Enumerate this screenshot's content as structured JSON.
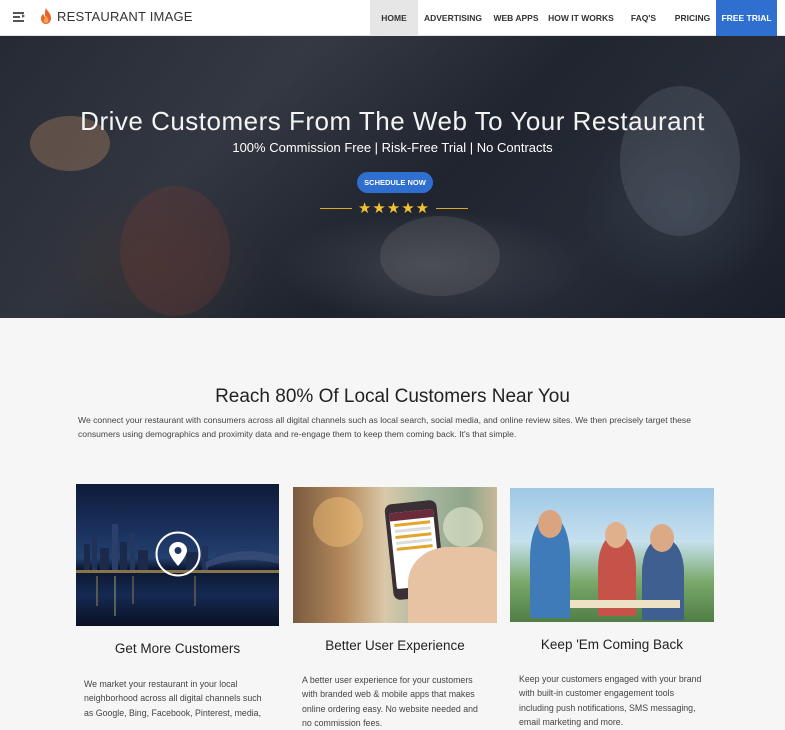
{
  "header": {
    "brand": "RESTAURANT IMAGE",
    "nav": [
      {
        "label": "HOME",
        "active": true
      },
      {
        "label": "ADVERTISING"
      },
      {
        "label": "WEB APPS"
      },
      {
        "label": "HOW IT WORKS"
      },
      {
        "label": "FAQ'S"
      },
      {
        "label": "PRICING"
      },
      {
        "label": "FREE TRIAL",
        "cta": true
      }
    ]
  },
  "hero": {
    "title": "Drive Customers From The Web To Your Restaurant",
    "subtitle": "100% Commission Free | Risk-Free Trial | No Contracts",
    "button": "SCHEDULE NOW",
    "rating": "★★★★★"
  },
  "intro": {
    "title": "Reach 80% Of Local Customers Near You",
    "text": "We connect your restaurant with consumers across all digital channels such as local search, social media, and online review sites. We then precisely target these consumers using demographics and proximity data and re-engage them to keep them coming back. It's that simple."
  },
  "cards": [
    {
      "title": "Get More Customers",
      "text": "We market your restaurant in your local neighborhood across all digital channels such as Google, Bing, Facebook, Pinterest, media,"
    },
    {
      "title": "Better User Experience",
      "text": "A better user experience for your customers with branded web & mobile apps that makes online ordering easy. No website needed and no commission fees."
    },
    {
      "title": "Keep 'Em Coming Back",
      "text": "Keep your customers engaged with your brand with built-in customer engagement tools including push notifications, SMS messaging, email marketing and more."
    }
  ],
  "colors": {
    "accent": "#2f6fcf",
    "flame": "#e8632b",
    "star": "#f1c232"
  },
  "icons": {
    "menu": "menu-toggle-icon",
    "logo": "flame-icon",
    "map": "map-pin-icon"
  }
}
